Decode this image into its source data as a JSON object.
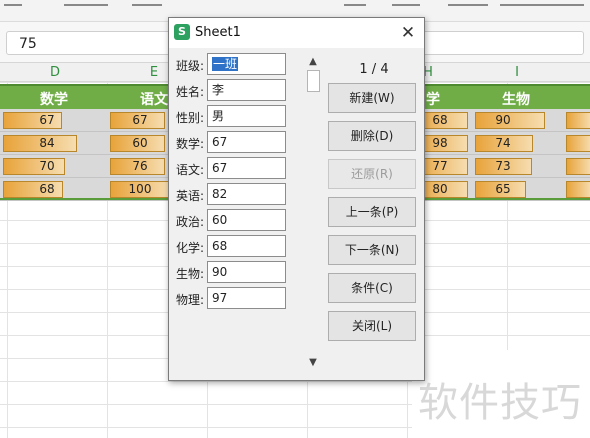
{
  "formula_bar": {
    "value": "75"
  },
  "columns": [
    "D",
    "E",
    "H",
    "I"
  ],
  "table_headers": [
    "数学",
    "语文",
    "学",
    "生物"
  ],
  "rows": [
    {
      "d": "67",
      "e": "67",
      "h": "68",
      "i": "90"
    },
    {
      "d": "84",
      "e": "60",
      "h": "98",
      "i": "74"
    },
    {
      "d": "70",
      "e": "76",
      "h": "77",
      "i": "73"
    },
    {
      "d": "68",
      "e": "100",
      "h": "80",
      "i": "65"
    }
  ],
  "bar_fill_fraction": {
    "d": [
      0.67,
      0.84,
      0.7,
      0.68
    ],
    "e": [
      0.67,
      0.6,
      0.76,
      1.0
    ],
    "i": [
      0.9,
      0.74,
      0.73,
      0.65
    ]
  },
  "colors": {
    "header_green": "#70ad47",
    "bar_orange": "#e8a33a",
    "dialog_bg": "#f0f0f0",
    "selection_blue": "#2f73c8"
  },
  "dialog": {
    "title": "Sheet1",
    "app_icon": "spreadsheet-app-icon",
    "close_icon": "close-icon",
    "counter": "1 / 4",
    "fields": [
      {
        "label": "班级:",
        "value": "一班"
      },
      {
        "label": "姓名:",
        "value": "李"
      },
      {
        "label": "性别:",
        "value": "男"
      },
      {
        "label": "数学:",
        "value": "67"
      },
      {
        "label": "语文:",
        "value": "67"
      },
      {
        "label": "英语:",
        "value": "82"
      },
      {
        "label": "政治:",
        "value": "60"
      },
      {
        "label": "化学:",
        "value": "68"
      },
      {
        "label": "生物:",
        "value": "90"
      },
      {
        "label": "物理:",
        "value": "97"
      }
    ],
    "buttons": {
      "new": "新建(W)",
      "delete": "删除(D)",
      "restore": "还原(R)",
      "prev": "上一条(P)",
      "next": "下一条(N)",
      "criteria": "条件(C)",
      "close": "关闭(L)"
    },
    "restore_disabled": true
  },
  "watermark": "软件技巧"
}
